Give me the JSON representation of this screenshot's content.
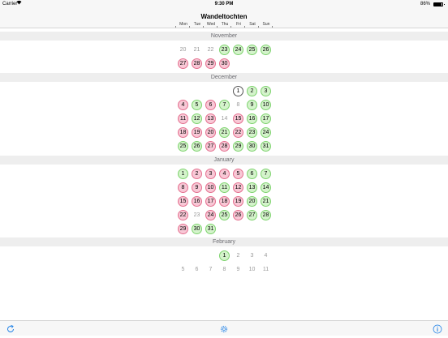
{
  "status": {
    "carrier": "Carrier",
    "time": "9:30 PM",
    "battery": "86%",
    "battery_level": 0.86
  },
  "nav": {
    "title": "Wandeltochten"
  },
  "weekdays": [
    "Mon",
    "Tue",
    "Wed",
    "Thu",
    "Fri",
    "Sat",
    "Sun"
  ],
  "colors": {
    "green_fill": "#d4f3cb",
    "green_border": "#7ed36e",
    "red_fill": "#f8c8d6",
    "red_border": "#e4708f",
    "accent": "#1a7ee6"
  },
  "months": [
    {
      "name": "November",
      "weeks": [
        [
          {
            "d": "20",
            "s": "muted"
          },
          {
            "d": "21",
            "s": "muted"
          },
          {
            "d": "22",
            "s": "muted"
          },
          {
            "d": "23",
            "s": "green"
          },
          {
            "d": "24",
            "s": "green"
          },
          {
            "d": "25",
            "s": "green"
          },
          {
            "d": "26",
            "s": "green"
          }
        ],
        [
          {
            "d": "27",
            "s": "red"
          },
          {
            "d": "28",
            "s": "red"
          },
          {
            "d": "29",
            "s": "red"
          },
          {
            "d": "30",
            "s": "red"
          },
          null,
          null,
          null
        ]
      ]
    },
    {
      "name": "December",
      "weeks": [
        [
          null,
          null,
          null,
          null,
          {
            "d": "1",
            "s": "today"
          },
          {
            "d": "2",
            "s": "green"
          },
          {
            "d": "3",
            "s": "green"
          }
        ],
        [
          {
            "d": "4",
            "s": "red"
          },
          {
            "d": "5",
            "s": "green"
          },
          {
            "d": "6",
            "s": "red"
          },
          {
            "d": "7",
            "s": "green"
          },
          {
            "d": "8",
            "s": "muted"
          },
          {
            "d": "9",
            "s": "green"
          },
          {
            "d": "10",
            "s": "green"
          }
        ],
        [
          {
            "d": "11",
            "s": "red"
          },
          {
            "d": "12",
            "s": "green"
          },
          {
            "d": "13",
            "s": "red"
          },
          {
            "d": "14",
            "s": "muted"
          },
          {
            "d": "15",
            "s": "red"
          },
          {
            "d": "16",
            "s": "green"
          },
          {
            "d": "17",
            "s": "green"
          }
        ],
        [
          {
            "d": "18",
            "s": "red"
          },
          {
            "d": "19",
            "s": "red"
          },
          {
            "d": "20",
            "s": "red"
          },
          {
            "d": "21",
            "s": "green"
          },
          {
            "d": "22",
            "s": "red"
          },
          {
            "d": "23",
            "s": "green"
          },
          {
            "d": "24",
            "s": "green"
          }
        ],
        [
          {
            "d": "25",
            "s": "green"
          },
          {
            "d": "26",
            "s": "green"
          },
          {
            "d": "27",
            "s": "red"
          },
          {
            "d": "28",
            "s": "red"
          },
          {
            "d": "29",
            "s": "green"
          },
          {
            "d": "30",
            "s": "green"
          },
          {
            "d": "31",
            "s": "green"
          }
        ]
      ]
    },
    {
      "name": "January",
      "weeks": [
        [
          {
            "d": "1",
            "s": "green"
          },
          {
            "d": "2",
            "s": "red"
          },
          {
            "d": "3",
            "s": "red"
          },
          {
            "d": "4",
            "s": "red"
          },
          {
            "d": "5",
            "s": "red"
          },
          {
            "d": "6",
            "s": "green"
          },
          {
            "d": "7",
            "s": "green"
          }
        ],
        [
          {
            "d": "8",
            "s": "red"
          },
          {
            "d": "9",
            "s": "red"
          },
          {
            "d": "10",
            "s": "red"
          },
          {
            "d": "11",
            "s": "green"
          },
          {
            "d": "12",
            "s": "red"
          },
          {
            "d": "13",
            "s": "green"
          },
          {
            "d": "14",
            "s": "green"
          }
        ],
        [
          {
            "d": "15",
            "s": "red"
          },
          {
            "d": "16",
            "s": "red"
          },
          {
            "d": "17",
            "s": "red"
          },
          {
            "d": "18",
            "s": "red"
          },
          {
            "d": "19",
            "s": "red"
          },
          {
            "d": "20",
            "s": "green"
          },
          {
            "d": "21",
            "s": "green"
          }
        ],
        [
          {
            "d": "22",
            "s": "red"
          },
          {
            "d": "23",
            "s": "muted"
          },
          {
            "d": "24",
            "s": "red"
          },
          {
            "d": "25",
            "s": "green"
          },
          {
            "d": "26",
            "s": "red"
          },
          {
            "d": "27",
            "s": "green"
          },
          {
            "d": "28",
            "s": "green"
          }
        ],
        [
          {
            "d": "29",
            "s": "red"
          },
          {
            "d": "30",
            "s": "green"
          },
          {
            "d": "31",
            "s": "green"
          },
          null,
          null,
          null,
          null
        ]
      ]
    },
    {
      "name": "February",
      "weeks": [
        [
          null,
          null,
          null,
          {
            "d": "1",
            "s": "green"
          },
          {
            "d": "2",
            "s": "muted"
          },
          {
            "d": "3",
            "s": "muted"
          },
          {
            "d": "4",
            "s": "muted"
          }
        ],
        [
          {
            "d": "5",
            "s": "muted"
          },
          {
            "d": "6",
            "s": "muted"
          },
          {
            "d": "7",
            "s": "muted"
          },
          {
            "d": "8",
            "s": "muted"
          },
          {
            "d": "9",
            "s": "muted"
          },
          {
            "d": "10",
            "s": "muted"
          },
          {
            "d": "11",
            "s": "muted"
          }
        ]
      ]
    }
  ],
  "toolbar": {
    "left_icon": "refresh-icon",
    "center_icon": "gear-icon",
    "right_icon": "info-icon"
  }
}
